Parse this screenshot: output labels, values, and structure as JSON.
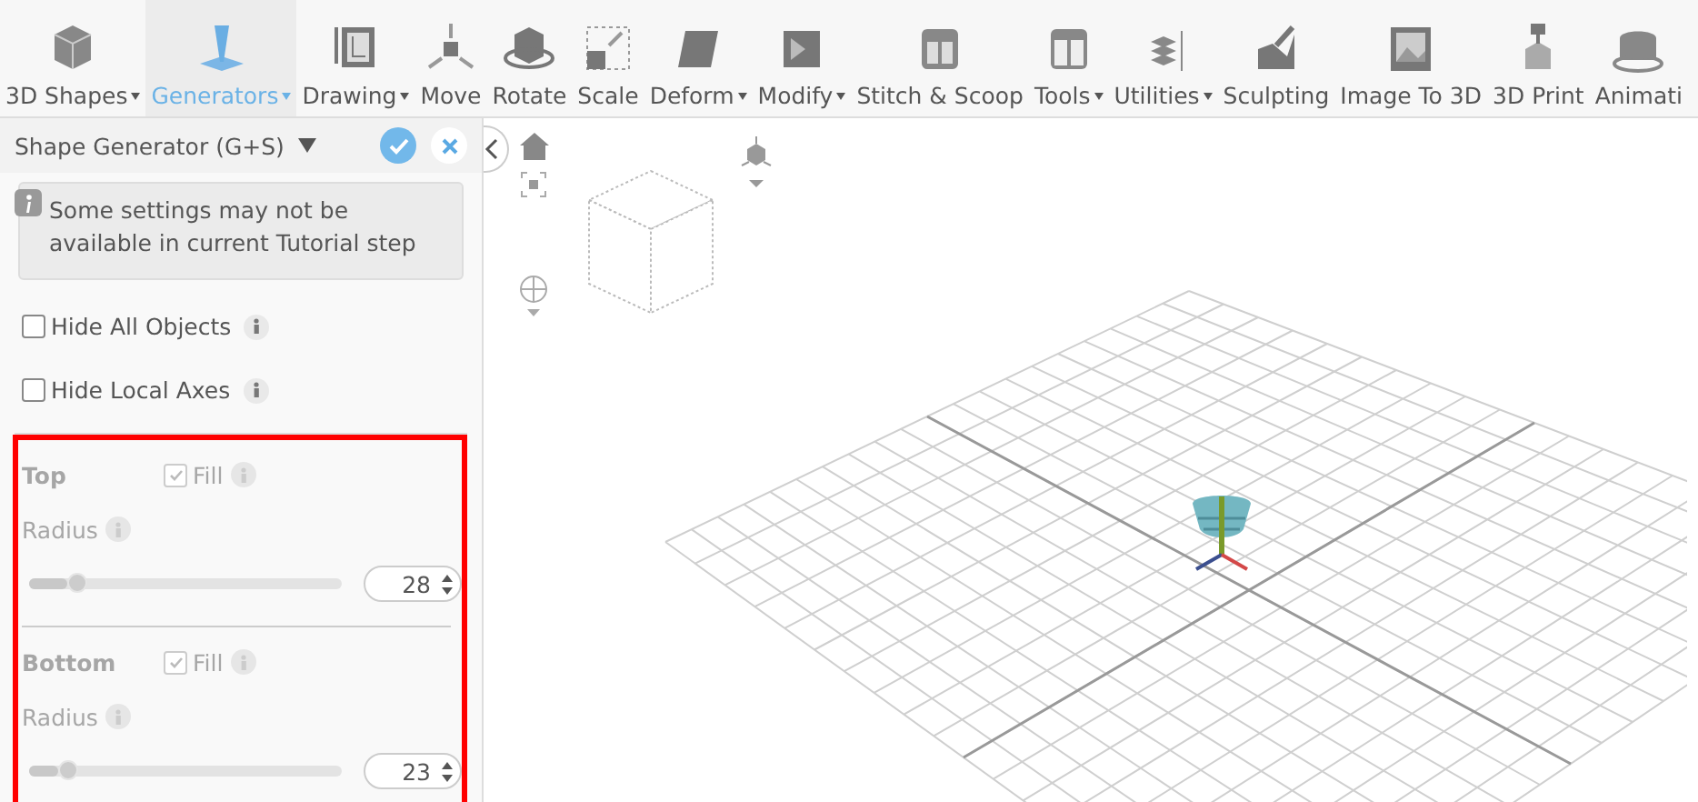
{
  "toolbar": [
    {
      "label": "3D Shapes",
      "dropdown": true,
      "selected": false
    },
    {
      "label": "Generators",
      "dropdown": true,
      "selected": true
    },
    {
      "label": "Drawing",
      "dropdown": true,
      "selected": false
    },
    {
      "label": "Move",
      "dropdown": false,
      "selected": false
    },
    {
      "label": "Rotate",
      "dropdown": false,
      "selected": false
    },
    {
      "label": "Scale",
      "dropdown": false,
      "selected": false
    },
    {
      "label": "Deform",
      "dropdown": true,
      "selected": false
    },
    {
      "label": "Modify",
      "dropdown": true,
      "selected": false
    },
    {
      "label": "Stitch & Scoop",
      "dropdown": false,
      "selected": false
    },
    {
      "label": "Tools",
      "dropdown": true,
      "selected": false
    },
    {
      "label": "Utilities",
      "dropdown": true,
      "selected": false
    },
    {
      "label": "Sculpting",
      "dropdown": false,
      "selected": false
    },
    {
      "label": "Image To 3D",
      "dropdown": false,
      "selected": false
    },
    {
      "label": "3D Print",
      "dropdown": false,
      "selected": false
    },
    {
      "label": "Animati",
      "dropdown": false,
      "selected": false
    }
  ],
  "panel": {
    "title": "Shape Generator (G+S)",
    "note": "Some settings may not be available in current Tutorial step",
    "options": [
      {
        "label": "Hide All Objects",
        "checked": false
      },
      {
        "label": "Hide Local Axes",
        "checked": false
      }
    ],
    "sections": [
      {
        "title": "Top",
        "fill": {
          "label": "Fill",
          "checked": true
        },
        "radius_label": "Radius",
        "level": 0.15,
        "value": "28",
        "disabled": true
      },
      {
        "title": "Bottom",
        "fill": {
          "label": "Fill",
          "checked": true
        },
        "radius_label": "Radius",
        "level": 0.12,
        "value": "23",
        "disabled": true
      }
    ],
    "highlighted": true
  }
}
